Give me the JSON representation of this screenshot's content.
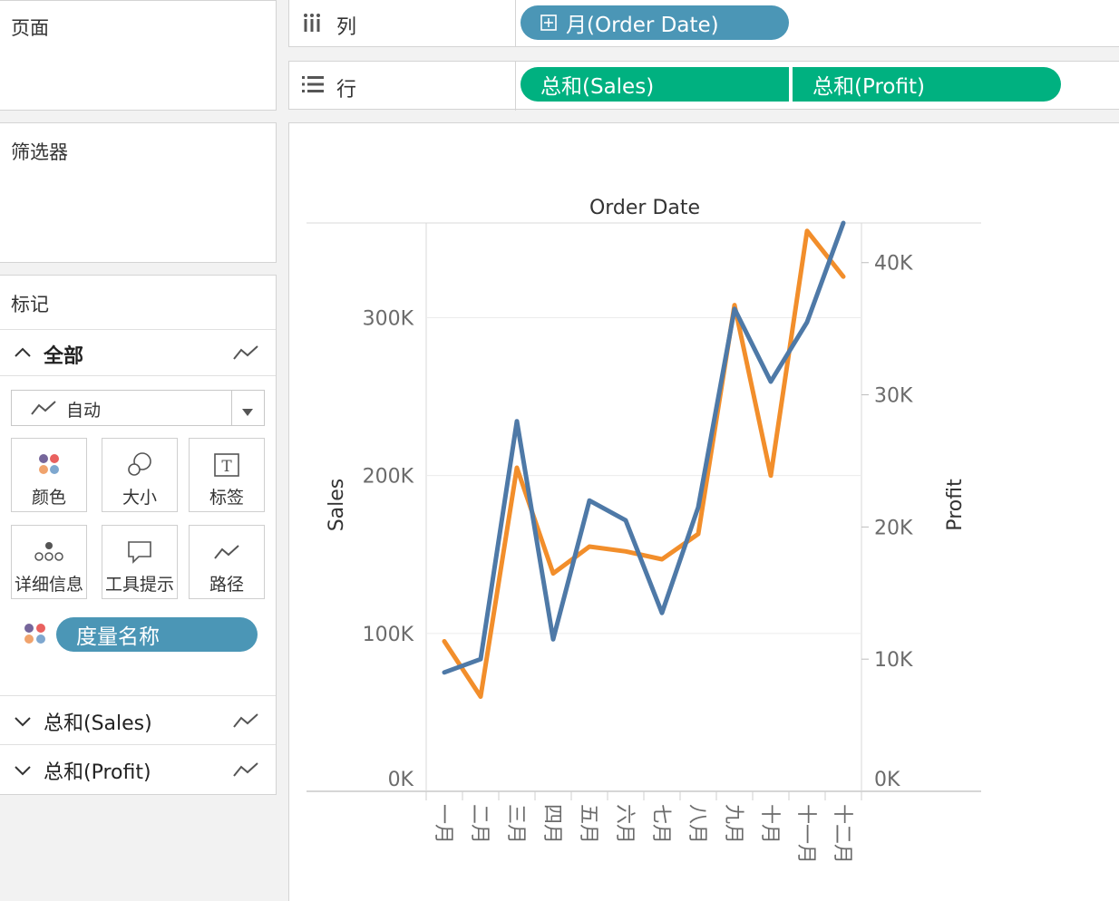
{
  "sidebar": {
    "pages_title": "页面",
    "filters_title": "筛选器",
    "marks_title": "标记",
    "all_label": "全部",
    "mark_type": "自动",
    "buttons": [
      "颜色",
      "大小",
      "标签",
      "详细信息",
      "工具提示",
      "路径"
    ],
    "color_pill": "度量名称",
    "measure_sections": [
      "总和(Sales)",
      "总和(Profit)"
    ]
  },
  "shelves": {
    "columns_label": "列",
    "rows_label": "行",
    "columns_pills": [
      "月(Order Date)"
    ],
    "rows_pills": [
      "总和(Sales)",
      "总和(Profit)"
    ]
  },
  "colors": {
    "sales": "#f28e2b",
    "profit": "#4e79a7",
    "pill_blue": "#4b96b6",
    "pill_green": "#00b180"
  },
  "chart_data": {
    "type": "line",
    "title": "Order Date",
    "ylabel_left": "Sales",
    "ylabel_right": "Profit",
    "categories": [
      "一月",
      "二月",
      "三月",
      "四月",
      "五月",
      "六月",
      "七月",
      "八月",
      "九月",
      "十月",
      "十一月",
      "十二月"
    ],
    "left_ticks": [
      "300K",
      "200K",
      "100K",
      "0K"
    ],
    "left_tick_values": [
      300000,
      200000,
      100000,
      0
    ],
    "right_ticks": [
      "40K",
      "30K",
      "20K",
      "10K",
      "0K"
    ],
    "right_tick_values": [
      40000,
      30000,
      20000,
      10000,
      0
    ],
    "ylim_left": [
      0,
      360000
    ],
    "ylim_right": [
      0,
      43000
    ],
    "series": [
      {
        "name": "Sales",
        "axis": "left",
        "values": [
          95000,
          60000,
          205000,
          138000,
          155000,
          152000,
          147000,
          163000,
          308000,
          200000,
          355000,
          326000
        ]
      },
      {
        "name": "Profit",
        "axis": "right",
        "values": [
          9000,
          10000,
          28000,
          11500,
          22000,
          20500,
          13500,
          21500,
          36500,
          31000,
          35500,
          43000
        ]
      }
    ],
    "grid": true
  }
}
